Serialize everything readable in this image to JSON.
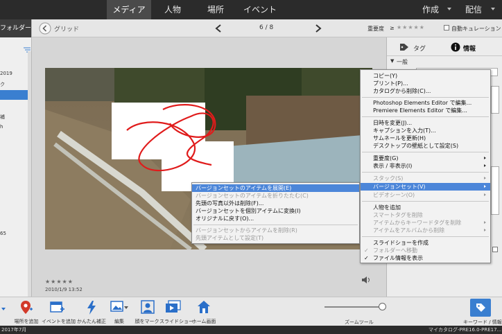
{
  "nav": {
    "tabs": [
      "メディア",
      "人物",
      "場所",
      "イベント"
    ],
    "active": 0,
    "create": "作成",
    "share": "配信"
  },
  "toolbar": {
    "back_label": "グリッド",
    "counter": "6 / 8",
    "rating_label": "重要度",
    "rating_op": "≥",
    "auto_curation": "自動キュレーション"
  },
  "left_panel": {
    "header": "フォルダー",
    "items": [
      "2019",
      "ク",
      "補",
      "h",
      "65"
    ]
  },
  "photo": {
    "date": "2010/1/9 13:52",
    "stars": "★★★★★"
  },
  "right_panel": {
    "tab_tag": "タグ",
    "tab_info": "情報",
    "section_general": "一般",
    "section_caret": "▼"
  },
  "context_menu_left": {
    "items": [
      {
        "label": "バージョンセットのアイテムを展開(E)",
        "state": "highlight"
      },
      {
        "label": "バージョンセットのアイテムを折りたたむ(C)",
        "state": "disabled"
      },
      {
        "label": "先頭の写真以外は削除(F)...",
        "state": "normal"
      },
      {
        "label": "バージョンセットを個別アイテムに変換(I)",
        "state": "normal"
      },
      {
        "label": "オリジナルに戻す(O)...",
        "state": "normal"
      },
      {
        "label": "バージョンセットからアイテムを削除(R)",
        "state": "disabled"
      },
      {
        "label": "先頭アイテムとして設定(T)",
        "state": "disabled"
      }
    ]
  },
  "context_menu_right": {
    "items": [
      {
        "label": "コピー(Y)",
        "state": "normal"
      },
      {
        "label": "プリント(P)...",
        "state": "normal"
      },
      {
        "label": "カタログから削除(C)...",
        "state": "normal"
      },
      {
        "label": "Photoshop Elements Editor で編集...",
        "state": "normal"
      },
      {
        "label": "Premiere Elements Editor で編集...",
        "state": "normal"
      },
      {
        "label": "日時を変更(J)...",
        "state": "normal"
      },
      {
        "label": "キャプションを入力(T)...",
        "state": "normal"
      },
      {
        "label": "サムネールを更新(H)",
        "state": "normal"
      },
      {
        "label": "デスクトップの壁紙として設定(S)",
        "state": "normal"
      },
      {
        "label": "重要度(G)",
        "state": "normal",
        "submenu": true
      },
      {
        "label": "表示 / 非表示(I)",
        "state": "normal",
        "submenu": true
      },
      {
        "label": "スタック(S)",
        "state": "disabled",
        "submenu": true
      },
      {
        "label": "バージョンセット(V)",
        "state": "highlight",
        "submenu": true
      },
      {
        "label": "ビデオシーン(O)",
        "state": "disabled",
        "submenu": true
      },
      {
        "label": "人物を追加",
        "state": "normal"
      },
      {
        "label": "スマートタグを削除",
        "state": "disabled"
      },
      {
        "label": "アイテムからキーワードタグを削除",
        "state": "disabled",
        "submenu": true
      },
      {
        "label": "アイテムをアルバムから削除",
        "state": "disabled",
        "submenu": true
      },
      {
        "label": "スライドショーを作成",
        "state": "normal"
      },
      {
        "label": "フォルダーへ移動",
        "state": "disabled",
        "check": true
      },
      {
        "label": "ファイル情報を表示",
        "state": "normal",
        "check": true
      }
    ]
  },
  "bottom": {
    "tools": [
      "場所を追加",
      "イベントを追加",
      "かんたん補正",
      "編集",
      "顔をマーク",
      "スライドショー",
      "ホーム画面"
    ],
    "zoom_label": "ズームツール",
    "keyword_label": "キーワード / 情報"
  },
  "status": {
    "left": "2017年7月",
    "right": "マイカタログ-PRE16.0-PRE17..."
  },
  "colors": {
    "topbar": "#2b2b2b",
    "highlight": "#4c86d9",
    "accent_blue": "#3a7fd0"
  }
}
